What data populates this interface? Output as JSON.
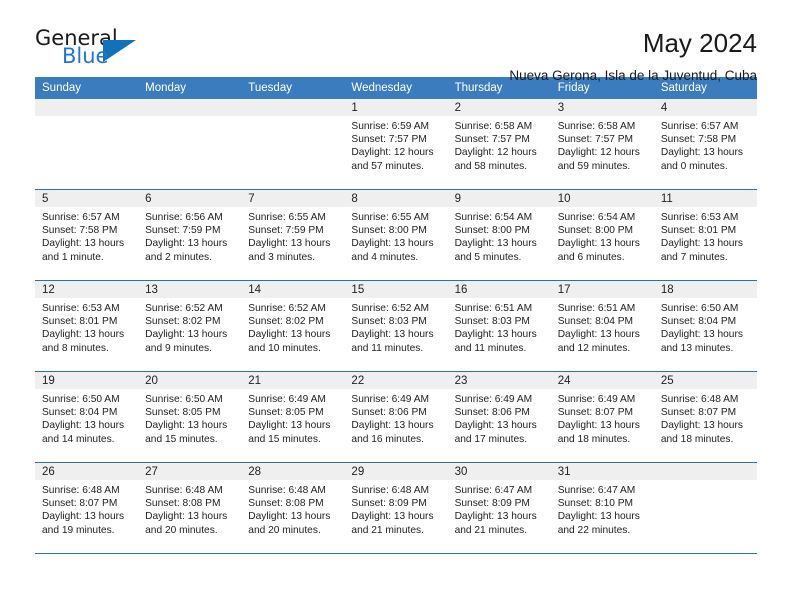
{
  "brand": {
    "name_part1": "General",
    "name_part2": "Blue",
    "triangle_color": "#1271bb",
    "blue_text_color": "#2176c7"
  },
  "header": {
    "title": "May 2024",
    "subtitle": "Nueva Gerona, Isla de la Juventud, Cuba"
  },
  "theme": {
    "header_row_bg": "#3a7cbe",
    "header_row_text": "#ffffff",
    "row_divider": "#2f6fa8",
    "daynum_bg": "#efefef",
    "body_text": "#222222"
  },
  "weekday_headers": [
    "Sunday",
    "Monday",
    "Tuesday",
    "Wednesday",
    "Thursday",
    "Friday",
    "Saturday"
  ],
  "weeks": [
    [
      {
        "day": "",
        "empty": true,
        "sunrise": "",
        "sunset": "",
        "daylight_1": "",
        "daylight_2": ""
      },
      {
        "day": "",
        "empty": true,
        "sunrise": "",
        "sunset": "",
        "daylight_1": "",
        "daylight_2": ""
      },
      {
        "day": "",
        "empty": true,
        "sunrise": "",
        "sunset": "",
        "daylight_1": "",
        "daylight_2": ""
      },
      {
        "day": "1",
        "sunrise": "Sunrise: 6:59 AM",
        "sunset": "Sunset: 7:57 PM",
        "daylight_1": "Daylight: 12 hours",
        "daylight_2": "and 57 minutes."
      },
      {
        "day": "2",
        "sunrise": "Sunrise: 6:58 AM",
        "sunset": "Sunset: 7:57 PM",
        "daylight_1": "Daylight: 12 hours",
        "daylight_2": "and 58 minutes."
      },
      {
        "day": "3",
        "sunrise": "Sunrise: 6:58 AM",
        "sunset": "Sunset: 7:57 PM",
        "daylight_1": "Daylight: 12 hours",
        "daylight_2": "and 59 minutes."
      },
      {
        "day": "4",
        "sunrise": "Sunrise: 6:57 AM",
        "sunset": "Sunset: 7:58 PM",
        "daylight_1": "Daylight: 13 hours",
        "daylight_2": "and 0 minutes."
      }
    ],
    [
      {
        "day": "5",
        "sunrise": "Sunrise: 6:57 AM",
        "sunset": "Sunset: 7:58 PM",
        "daylight_1": "Daylight: 13 hours",
        "daylight_2": "and 1 minute."
      },
      {
        "day": "6",
        "sunrise": "Sunrise: 6:56 AM",
        "sunset": "Sunset: 7:59 PM",
        "daylight_1": "Daylight: 13 hours",
        "daylight_2": "and 2 minutes."
      },
      {
        "day": "7",
        "sunrise": "Sunrise: 6:55 AM",
        "sunset": "Sunset: 7:59 PM",
        "daylight_1": "Daylight: 13 hours",
        "daylight_2": "and 3 minutes."
      },
      {
        "day": "8",
        "sunrise": "Sunrise: 6:55 AM",
        "sunset": "Sunset: 8:00 PM",
        "daylight_1": "Daylight: 13 hours",
        "daylight_2": "and 4 minutes."
      },
      {
        "day": "9",
        "sunrise": "Sunrise: 6:54 AM",
        "sunset": "Sunset: 8:00 PM",
        "daylight_1": "Daylight: 13 hours",
        "daylight_2": "and 5 minutes."
      },
      {
        "day": "10",
        "sunrise": "Sunrise: 6:54 AM",
        "sunset": "Sunset: 8:00 PM",
        "daylight_1": "Daylight: 13 hours",
        "daylight_2": "and 6 minutes."
      },
      {
        "day": "11",
        "sunrise": "Sunrise: 6:53 AM",
        "sunset": "Sunset: 8:01 PM",
        "daylight_1": "Daylight: 13 hours",
        "daylight_2": "and 7 minutes."
      }
    ],
    [
      {
        "day": "12",
        "sunrise": "Sunrise: 6:53 AM",
        "sunset": "Sunset: 8:01 PM",
        "daylight_1": "Daylight: 13 hours",
        "daylight_2": "and 8 minutes."
      },
      {
        "day": "13",
        "sunrise": "Sunrise: 6:52 AM",
        "sunset": "Sunset: 8:02 PM",
        "daylight_1": "Daylight: 13 hours",
        "daylight_2": "and 9 minutes."
      },
      {
        "day": "14",
        "sunrise": "Sunrise: 6:52 AM",
        "sunset": "Sunset: 8:02 PM",
        "daylight_1": "Daylight: 13 hours",
        "daylight_2": "and 10 minutes."
      },
      {
        "day": "15",
        "sunrise": "Sunrise: 6:52 AM",
        "sunset": "Sunset: 8:03 PM",
        "daylight_1": "Daylight: 13 hours",
        "daylight_2": "and 11 minutes."
      },
      {
        "day": "16",
        "sunrise": "Sunrise: 6:51 AM",
        "sunset": "Sunset: 8:03 PM",
        "daylight_1": "Daylight: 13 hours",
        "daylight_2": "and 11 minutes."
      },
      {
        "day": "17",
        "sunrise": "Sunrise: 6:51 AM",
        "sunset": "Sunset: 8:04 PM",
        "daylight_1": "Daylight: 13 hours",
        "daylight_2": "and 12 minutes."
      },
      {
        "day": "18",
        "sunrise": "Sunrise: 6:50 AM",
        "sunset": "Sunset: 8:04 PM",
        "daylight_1": "Daylight: 13 hours",
        "daylight_2": "and 13 minutes."
      }
    ],
    [
      {
        "day": "19",
        "sunrise": "Sunrise: 6:50 AM",
        "sunset": "Sunset: 8:04 PM",
        "daylight_1": "Daylight: 13 hours",
        "daylight_2": "and 14 minutes."
      },
      {
        "day": "20",
        "sunrise": "Sunrise: 6:50 AM",
        "sunset": "Sunset: 8:05 PM",
        "daylight_1": "Daylight: 13 hours",
        "daylight_2": "and 15 minutes."
      },
      {
        "day": "21",
        "sunrise": "Sunrise: 6:49 AM",
        "sunset": "Sunset: 8:05 PM",
        "daylight_1": "Daylight: 13 hours",
        "daylight_2": "and 15 minutes."
      },
      {
        "day": "22",
        "sunrise": "Sunrise: 6:49 AM",
        "sunset": "Sunset: 8:06 PM",
        "daylight_1": "Daylight: 13 hours",
        "daylight_2": "and 16 minutes."
      },
      {
        "day": "23",
        "sunrise": "Sunrise: 6:49 AM",
        "sunset": "Sunset: 8:06 PM",
        "daylight_1": "Daylight: 13 hours",
        "daylight_2": "and 17 minutes."
      },
      {
        "day": "24",
        "sunrise": "Sunrise: 6:49 AM",
        "sunset": "Sunset: 8:07 PM",
        "daylight_1": "Daylight: 13 hours",
        "daylight_2": "and 18 minutes."
      },
      {
        "day": "25",
        "sunrise": "Sunrise: 6:48 AM",
        "sunset": "Sunset: 8:07 PM",
        "daylight_1": "Daylight: 13 hours",
        "daylight_2": "and 18 minutes."
      }
    ],
    [
      {
        "day": "26",
        "sunrise": "Sunrise: 6:48 AM",
        "sunset": "Sunset: 8:07 PM",
        "daylight_1": "Daylight: 13 hours",
        "daylight_2": "and 19 minutes."
      },
      {
        "day": "27",
        "sunrise": "Sunrise: 6:48 AM",
        "sunset": "Sunset: 8:08 PM",
        "daylight_1": "Daylight: 13 hours",
        "daylight_2": "and 20 minutes."
      },
      {
        "day": "28",
        "sunrise": "Sunrise: 6:48 AM",
        "sunset": "Sunset: 8:08 PM",
        "daylight_1": "Daylight: 13 hours",
        "daylight_2": "and 20 minutes."
      },
      {
        "day": "29",
        "sunrise": "Sunrise: 6:48 AM",
        "sunset": "Sunset: 8:09 PM",
        "daylight_1": "Daylight: 13 hours",
        "daylight_2": "and 21 minutes."
      },
      {
        "day": "30",
        "sunrise": "Sunrise: 6:47 AM",
        "sunset": "Sunset: 8:09 PM",
        "daylight_1": "Daylight: 13 hours",
        "daylight_2": "and 21 minutes."
      },
      {
        "day": "31",
        "sunrise": "Sunrise: 6:47 AM",
        "sunset": "Sunset: 8:10 PM",
        "daylight_1": "Daylight: 13 hours",
        "daylight_2": "and 22 minutes."
      },
      {
        "day": "",
        "empty": true,
        "sunrise": "",
        "sunset": "",
        "daylight_1": "",
        "daylight_2": ""
      }
    ]
  ]
}
